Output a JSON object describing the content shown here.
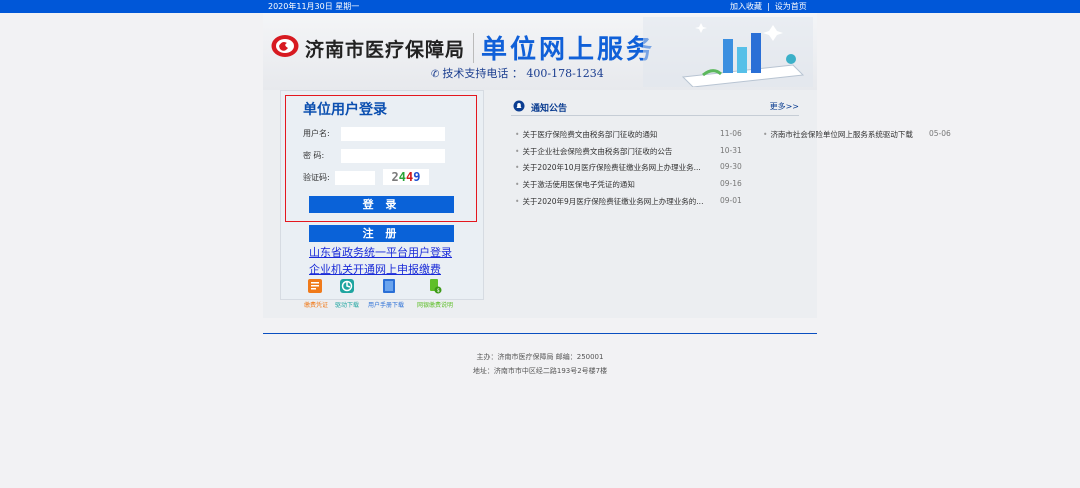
{
  "topbar": {
    "date": "2020年11月30日 星期一",
    "add_fav": "加入收藏",
    "sep": "|",
    "set_home": "设为首页"
  },
  "header": {
    "bureau": "济南市医疗保障局",
    "service": "单位网上服务",
    "hotline": "技术支持电话 ： 400-178-1234"
  },
  "login": {
    "title": "单位用户登录",
    "username_label": "用户名:",
    "password_label": "密  码:",
    "captcha_label": "验证码:",
    "captcha_chars": [
      "2",
      "4",
      "4",
      "9"
    ],
    "login_button": "登 录",
    "register_button": "注 册"
  },
  "links": [
    "山东省政务统一平台用户登录",
    "企业机关开通网上申报缴费"
  ],
  "quick_links": [
    {
      "label": "缴费凭证",
      "icon": "receipt-icon",
      "color": "#f07a1a"
    },
    {
      "label": "驱动下载",
      "icon": "driver-download-icon",
      "color": "#1fa5a0"
    },
    {
      "label": "用户手册下载",
      "icon": "manual-icon",
      "color": "#2a6fd6"
    },
    {
      "label": "网银缴费说明",
      "icon": "bank-pay-icon",
      "color": "#5fbf2a"
    }
  ],
  "notices": {
    "title": "通知公告",
    "more": "更多>>",
    "items": [
      {
        "title": "关于医疗保险费文由税务部门征收的通知",
        "date": "11-06"
      },
      {
        "title": "关于企业社会保险费文由税务部门征收的公告",
        "date": "10-31"
      },
      {
        "title": "关于2020年10月医疗保险费征缴业务网上办理业务...",
        "date": "09-30"
      },
      {
        "title": "关于激活使用医保电子凭证的通知",
        "date": "09-16"
      },
      {
        "title": "关于2020年9月医疗保险费征缴业务网上办理业务的...",
        "date": "09-01"
      }
    ],
    "side_item": {
      "title": "济南市社会保险单位网上服务系统驱动下载",
      "date": "05-06"
    }
  },
  "footer": {
    "line1": "主办：济南市医疗保障局  邮编：250001",
    "line2": "地址：济南市市中区经二路193号2号楼7楼"
  },
  "colors": {
    "brand_blue": "#0057d8",
    "highlight_red": "#e4171e"
  }
}
